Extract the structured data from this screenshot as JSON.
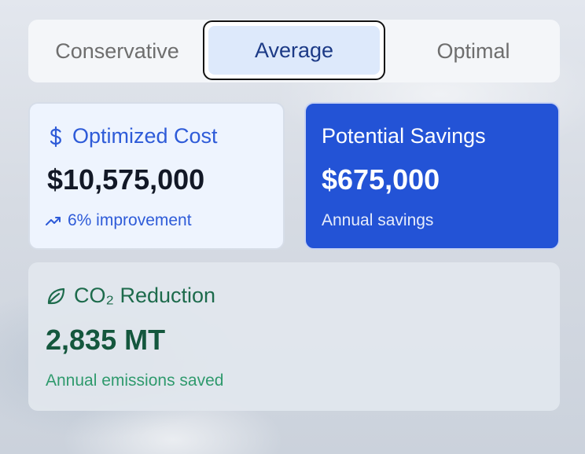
{
  "tabs": [
    {
      "label": "Conservative",
      "selected": false
    },
    {
      "label": "Average",
      "selected": true
    },
    {
      "label": "Optimal",
      "selected": false
    }
  ],
  "cards": {
    "cost": {
      "icon": "dollar-icon",
      "title": "Optimized Cost",
      "value": "$10,575,000",
      "trend_icon": "trending-up-icon",
      "note": "6% improvement"
    },
    "savings": {
      "title": "Potential Savings",
      "value": "$675,000",
      "note": "Annual savings"
    },
    "co2": {
      "icon": "leaf-icon",
      "title": "CO₂ Reduction",
      "value": "2,835 MT",
      "note": "Annual emissions saved"
    }
  },
  "colors": {
    "accent_blue": "#2353d6",
    "selected_tab_bg": "#dde9fb",
    "green": "#1d6b4c"
  }
}
